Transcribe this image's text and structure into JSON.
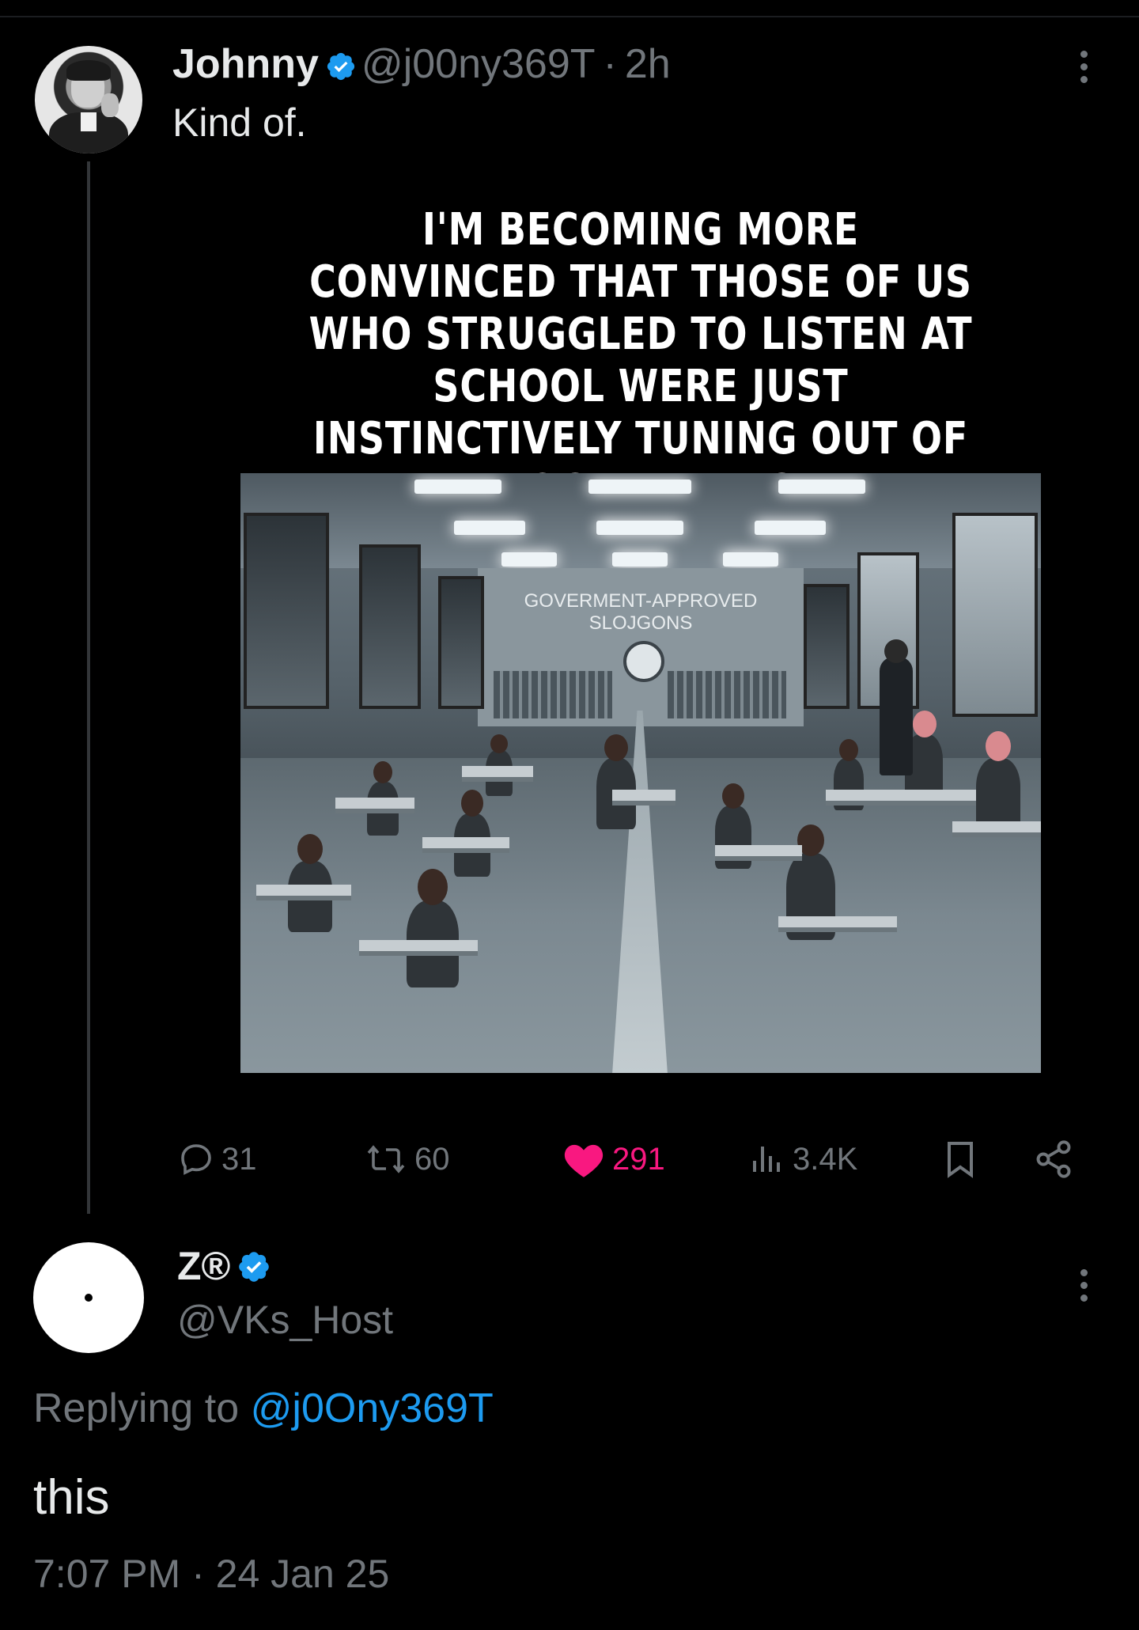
{
  "tweet": {
    "author_name": "Johnny",
    "author_handle": "@j00ny369T",
    "age": "2h",
    "separator": "·",
    "text": "Kind of.",
    "meme": {
      "caption": "I'M BECOMING MORE CONVINCED THAT THOSE OF US WHO STRUGGLED TO LISTEN AT SCHOOL WERE JUST INSTINCTIVELY TUNING OUT OF PROGRAMMING.",
      "sign_line1": "GOVERMENT-APPROVED",
      "sign_line2": "SLOJGONS"
    },
    "actions": {
      "replies": "31",
      "reposts": "60",
      "likes": "291",
      "views": "3.4K"
    }
  },
  "reply": {
    "author_name": "Z®",
    "author_handle": "@VKs_Host",
    "replying_prefix": "Replying to ",
    "replying_to": "@j0Ony369T",
    "text": "this",
    "timestamp": "7:07 PM · 24 Jan 25"
  },
  "colors": {
    "background": "#000000",
    "text": "#e7e9ea",
    "secondary": "#71767b",
    "link": "#1d9bf0",
    "like": "#f91880",
    "verified": "#1d9bf0"
  },
  "icons": [
    "verified-badge-icon",
    "more-options-icon",
    "reply-icon",
    "repost-icon",
    "heart-icon",
    "views-icon",
    "bookmark-icon",
    "share-icon"
  ]
}
